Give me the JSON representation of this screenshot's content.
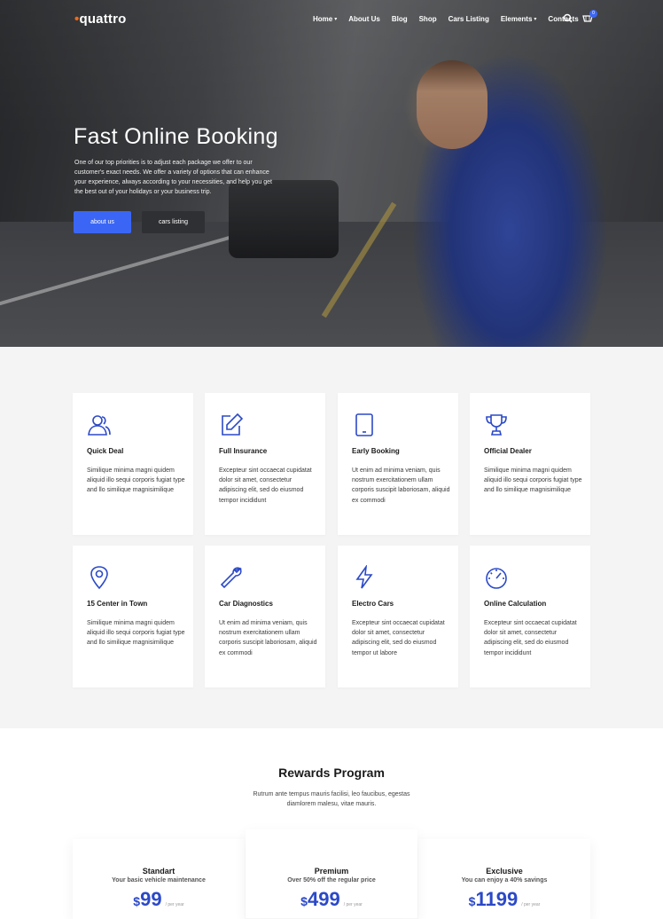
{
  "brand": {
    "logo_text": "quattro",
    "accent": "#f06a1c",
    "primary": "#3b66f5",
    "price_blue": "#2b49c8"
  },
  "nav": {
    "items": [
      {
        "label": "Home",
        "dropdown": true
      },
      {
        "label": "About Us",
        "dropdown": false
      },
      {
        "label": "Blog",
        "dropdown": false
      },
      {
        "label": "Shop",
        "dropdown": false
      },
      {
        "label": "Cars Listing",
        "dropdown": false
      },
      {
        "label": "Elements",
        "dropdown": true
      },
      {
        "label": "Contacts",
        "dropdown": false
      }
    ],
    "cart_count": "0",
    "icons": [
      "search-icon",
      "cart-icon"
    ]
  },
  "hero": {
    "title": "Fast Online Booking",
    "text": "One of our top priorities is to adjust each package we offer to our customer's exact needs. We offer a variety of options that can enhance your experience, always according to your necessities, and help you get the best out of your holidays or your business trip.",
    "btn_primary": "about us",
    "btn_secondary": "cars listing"
  },
  "features": [
    {
      "icon": "users-icon",
      "title": "Quick Deal",
      "text": "Similique minima magni quidem aliquid illo sequi corporis fugiat type and llo similique magnisimilique"
    },
    {
      "icon": "edit-icon",
      "title": "Full Insurance",
      "text": "Excepteur sint occaecat cupidatat dolor sit amet, consectetur adipiscing elit, sed do eiusmod tempor incididunt"
    },
    {
      "icon": "tablet-icon",
      "title": "Early Booking",
      "text": "Ut enim ad minima veniam, quis nostrum exercitationem ullam corporis suscipit laboriosam, aliquid ex commodi"
    },
    {
      "icon": "trophy-icon",
      "title": "Official Dealer",
      "text": "Similique minima magni quidem aliquid illo sequi corporis fugiat type and llo similique magnisimilique"
    },
    {
      "icon": "map-pin-icon",
      "title": "15 Center in Town",
      "text": "Similique minima magni quidem aliquid illo sequi corporis fugiat type and llo similique magnisimilique"
    },
    {
      "icon": "wrench-icon",
      "title": "Car Diagnostics",
      "text": "Ut enim ad minima veniam, quis nostrum exercitationem ullam corporis suscipit laboriosam, aliquid ex commodi"
    },
    {
      "icon": "lightning-icon",
      "title": "Electro Cars",
      "text": "Excepteur sint occaecat cupidatat dolor sit amet, consectetur adipiscing elit, sed do eiusmod tempor ut labore"
    },
    {
      "icon": "speedometer-icon",
      "title": "Online Calculation",
      "text": "Excepteur sint occaecat cupidatat dolor sit amet, consectetur adipiscing elit, sed do eiusmod tempor incididunt"
    }
  ],
  "rewards": {
    "title": "Rewards Program",
    "subtitle": "Rutrum ante tempus mauris facilisi, leo faucibus, egestas diamlorem malesu, vitae mauris.",
    "plans": [
      {
        "name": "Standart",
        "desc": "Your basic vehicle maintenance",
        "currency": "$",
        "price": "99",
        "period": "/ per year"
      },
      {
        "name": "Premium",
        "desc": "Over 50% off the regular price",
        "currency": "$",
        "price": "499",
        "period": "/ per year"
      },
      {
        "name": "Exclusive",
        "desc": "You can enjoy a 40% savings",
        "currency": "$",
        "price": "1199",
        "period": "/ per year"
      }
    ]
  }
}
